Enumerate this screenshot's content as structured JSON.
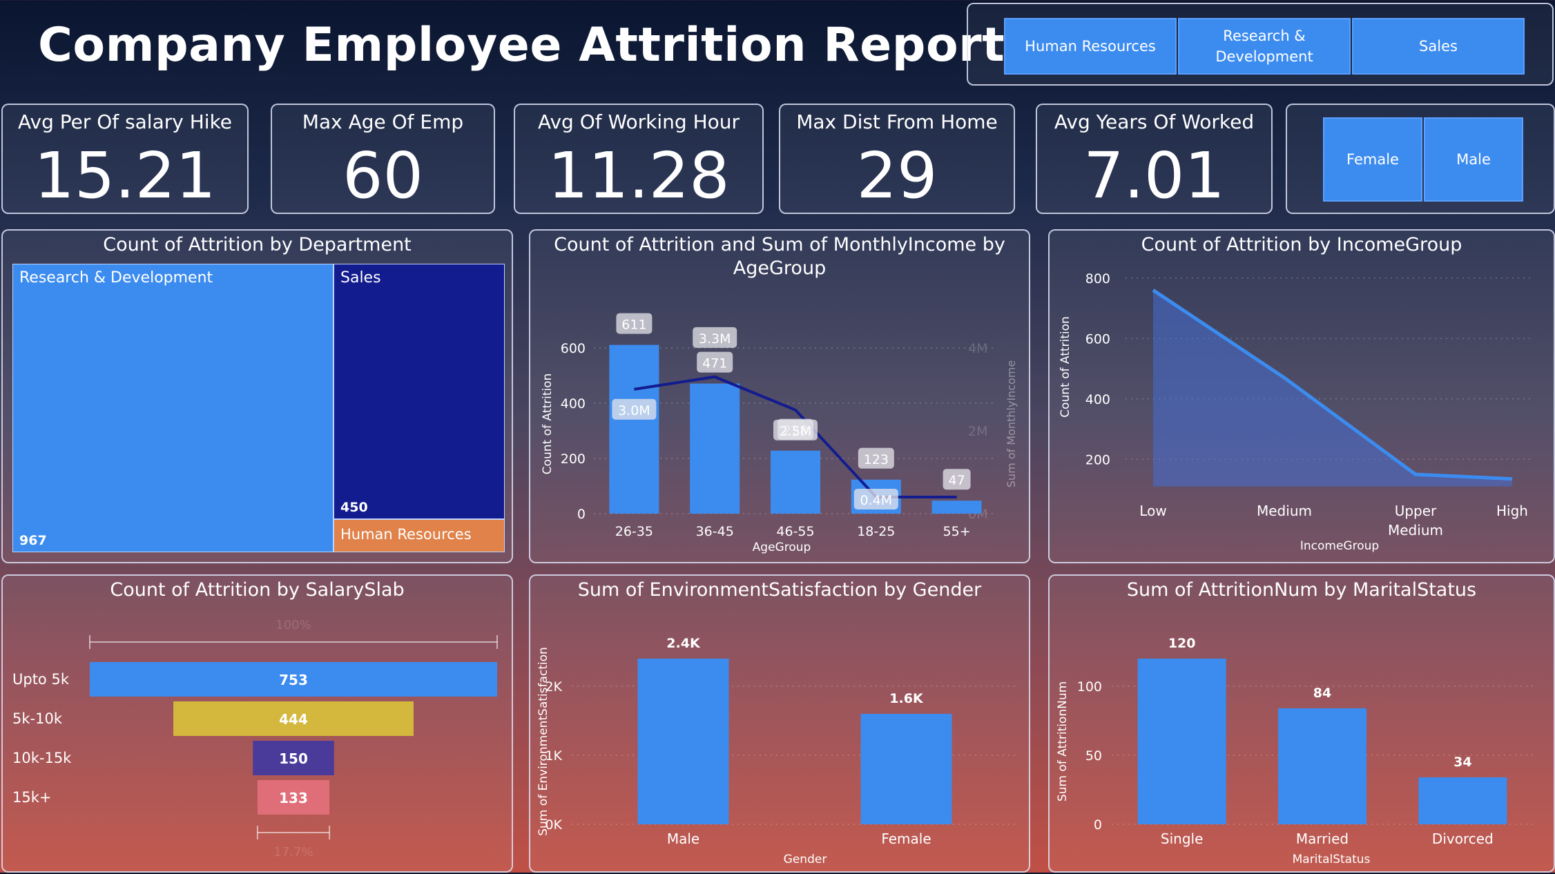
{
  "title": "Company Employee Attrition Report",
  "department_slicer": [
    "Human Resources",
    "Research & Development",
    "Sales"
  ],
  "gender_slicer": [
    "Female",
    "Male"
  ],
  "kpis": [
    {
      "label": "Avg Per Of salary Hike",
      "value": "15.21"
    },
    {
      "label": "Max Age Of Emp",
      "value": "60"
    },
    {
      "label": "Avg Of Working Hour",
      "value": "11.28"
    },
    {
      "label": "Max Dist From Home",
      "value": "29"
    },
    {
      "label": "Avg Years Of Worked",
      "value": "7.01"
    }
  ],
  "colors": {
    "blue": "#3c8cf0",
    "navy": "#1a1f9a",
    "orange": "#e0824a",
    "gold": "#d4b83e",
    "purple": "#4a3a9a",
    "pink": "#e06e78"
  },
  "chart_data": [
    {
      "type": "treemap",
      "title": "Count of Attrition by Department",
      "categories": [
        "Research & Development",
        "Sales",
        "Human Resources"
      ],
      "values": [
        967,
        450,
        63
      ],
      "value_labels": [
        "967",
        "450",
        ""
      ]
    },
    {
      "type": "bar+line",
      "title": "Count of Attrition and Sum of MonthlyIncome by AgeGroup",
      "categories": [
        "26-35",
        "36-45",
        "46-55",
        "18-25",
        "55+"
      ],
      "xlabel": "AgeGroup",
      "ylabel": "Count of Attrition",
      "y2label": "Sum of MonthlyIncome",
      "yticks": [
        "0",
        "200",
        "400",
        "600"
      ],
      "y2ticks": [
        "0M",
        "2M",
        "4M"
      ],
      "ylim": [
        0,
        650
      ],
      "y2lim": [
        0,
        4.33
      ],
      "series": [
        {
          "kind": "bar",
          "values": [
            611,
            471,
            228,
            123,
            47
          ],
          "labels": [
            "611",
            "471",
            "228",
            "123",
            "47"
          ]
        },
        {
          "kind": "line",
          "values": [
            3.0,
            3.3,
            2.5,
            0.4,
            0.4
          ],
          "labels": [
            "3.0M",
            "3.3M",
            "2.5M",
            "0.4M",
            ""
          ]
        }
      ]
    },
    {
      "type": "area",
      "title": "Count of Attrition by IncomeGroup",
      "categories": [
        "Low",
        "Medium",
        "Upper Medium",
        "High"
      ],
      "values": [
        760,
        470,
        150,
        135
      ],
      "xlabel": "IncomeGroup",
      "ylabel": "Count of Attrition",
      "yticks": [
        "200",
        "400",
        "600",
        "800"
      ],
      "ylim": [
        100,
        820
      ]
    },
    {
      "type": "funnel",
      "title": "Count of Attrition by SalarySlab",
      "categories": [
        "Upto 5k",
        "5k-10k",
        "10k-15k",
        "15k+"
      ],
      "values": [
        753,
        444,
        150,
        133
      ],
      "value_labels": [
        "753",
        "444",
        "150",
        "133"
      ],
      "top_pct": "100%",
      "bottom_pct": "17.7%"
    },
    {
      "type": "bar",
      "title": "Sum of EnvironmentSatisfaction by Gender",
      "categories": [
        "Male",
        "Female"
      ],
      "values": [
        2400,
        1600
      ],
      "value_labels": [
        "2.4K",
        "1.6K"
      ],
      "xlabel": "Gender",
      "ylabel": "Sum of EnvironmentSatisfaction",
      "yticks": [
        "0K",
        "1K",
        "2K"
      ],
      "ylim": [
        0,
        2600
      ]
    },
    {
      "type": "bar",
      "title": "Sum of AttritionNum by MaritalStatus",
      "categories": [
        "Single",
        "Married",
        "Divorced"
      ],
      "values": [
        120,
        84,
        34
      ],
      "value_labels": [
        "120",
        "84",
        "34"
      ],
      "xlabel": "MaritalStatus",
      "ylabel": "Sum of AttritionNum",
      "yticks": [
        "0",
        "50",
        "100"
      ],
      "ylim": [
        0,
        130
      ]
    }
  ]
}
